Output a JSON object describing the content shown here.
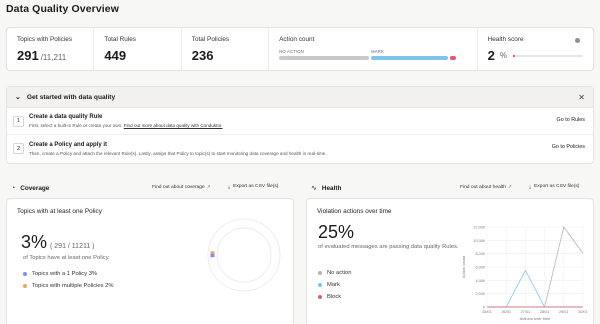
{
  "page_title": "Data Quality Overview",
  "kpis": {
    "topics": {
      "label": "Topics with Policies",
      "value": "291",
      "sub": "/11,211"
    },
    "rules": {
      "label": "Total Rules",
      "value": "449"
    },
    "policies": {
      "label": "Total Policies",
      "value": "236"
    },
    "action_count": {
      "label": "Action count",
      "no_action_label": "NO ACTION",
      "mark_label": "MARK",
      "shares": {
        "no_action": 0.48,
        "mark": 0.41,
        "block": 0.03
      }
    },
    "health": {
      "label": "Health score",
      "value": "2",
      "unit": "%",
      "fill": 0.02
    }
  },
  "get_started": {
    "title": "Get started with data quality",
    "steps": [
      {
        "num": "1",
        "title": "Create a data quality Rule",
        "desc_pre": "First, select a built-in Rule or create your own.",
        "desc_link": "Find out more about data quality with Conduktor.",
        "button": "Go to Rules"
      },
      {
        "num": "2",
        "title": "Create a Policy and apply it",
        "desc": "Then, create a Policy and attach the relevant Rule(s). Lastly, assign that Policy to topic(s) to start monitoring data coverage and health in real-time.",
        "button": "Go to Policies"
      }
    ]
  },
  "coverage": {
    "title": "Coverage",
    "find_out": "Find out about coverage",
    "export": "Export as CSV file(s)",
    "card_title": "Topics with at least one Policy",
    "percent": "3%",
    "sub": "( 291 / 11211 )",
    "desc": "of Topics have at least one Policy.",
    "legend": [
      {
        "label": "Topics with a 1 Policy 3%",
        "color": "#7b8ff0"
      },
      {
        "label": "Topics with multiple Policies 2%",
        "color": "#f2a35d"
      }
    ],
    "share": {
      "one": 0.03,
      "multiple": 0.02
    }
  },
  "health": {
    "title": "Health",
    "find_out": "Find out about health",
    "export": "Export as CSV file(s)",
    "card_title": "Violation actions over time",
    "percent": "25%",
    "desc": "of evaluated messages are passing data quality Rules.",
    "legend": [
      {
        "label": "No action",
        "color": "#b5b5b5"
      },
      {
        "label": "Mark",
        "color": "#7fc3ec"
      },
      {
        "label": "Block",
        "color": "#e05b6d"
      }
    ]
  },
  "chart_data": {
    "type": "line",
    "title": "",
    "xlabel": "Actions over time",
    "ylabel": "Action count",
    "x": [
      "25/01",
      "26/01",
      "27/01",
      "28/01",
      "29/01",
      "30/01"
    ],
    "ylim": [
      0,
      12000
    ],
    "yticks": [
      "0",
      "2,000",
      "4,000",
      "6,000",
      "8,000",
      "10,000",
      "12,000"
    ],
    "series": [
      {
        "name": "No action",
        "color": "#b5b5b5",
        "values": [
          0,
          0,
          0,
          0,
          12000,
          8000
        ]
      },
      {
        "name": "Mark",
        "color": "#7fc3ec",
        "values": [
          0,
          0,
          5500,
          0,
          0,
          0
        ]
      },
      {
        "name": "Block",
        "color": "#e05b6d",
        "values": [
          0,
          0,
          0,
          0,
          0,
          0
        ]
      }
    ],
    "grid": true,
    "legend": "left"
  }
}
